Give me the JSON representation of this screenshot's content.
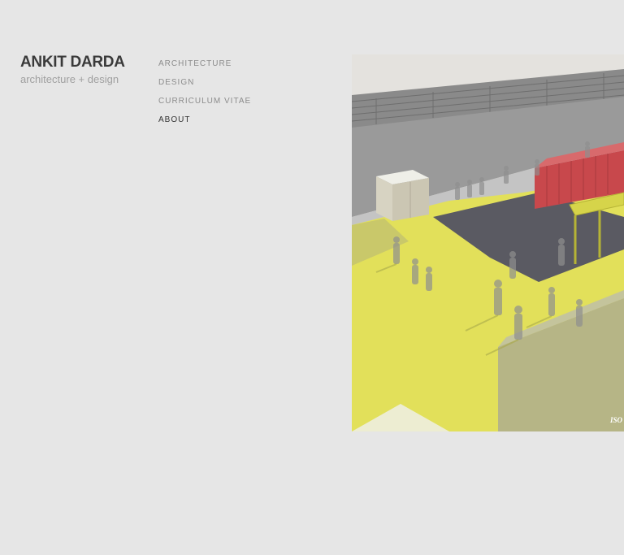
{
  "brand": {
    "name": "ANKIT DARDA",
    "tagline": "architecture + design"
  },
  "nav": {
    "items": [
      {
        "label": "ARCHITECTURE",
        "active": false
      },
      {
        "label": "DESIGN",
        "active": false
      },
      {
        "label": "CURRICULUM VITAE",
        "active": false
      },
      {
        "label": "ABOUT",
        "active": true
      }
    ]
  },
  "hero": {
    "caption": "ISO",
    "colors": {
      "ground": "#e2e05a",
      "wall": "#8c8c8c",
      "container": "#c8484c",
      "shadow": "#5a5a60"
    }
  }
}
